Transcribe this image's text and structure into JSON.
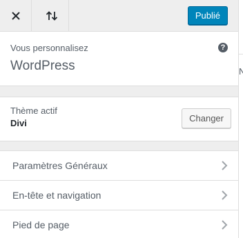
{
  "header": {
    "close_icon": "close-icon",
    "sort_icon": "sort-arrows-icon",
    "publish_label": "Publié",
    "accent_color": "#0085ba"
  },
  "info": {
    "subtitle": "Vous personnalisez",
    "site_name": "WordPress",
    "help_icon": "help-icon",
    "help_glyph": "?"
  },
  "theme": {
    "label": "Thème actif",
    "name": "Divi",
    "change_label": "Changer"
  },
  "menu": {
    "items": [
      {
        "label": "Paramètres Généraux",
        "icon": "chevron-right-icon"
      },
      {
        "label": "En-tête et navigation",
        "icon": "chevron-right-icon"
      },
      {
        "label": "Pied de page",
        "icon": "chevron-right-icon"
      }
    ]
  },
  "preview": {
    "partial_text": "N"
  }
}
